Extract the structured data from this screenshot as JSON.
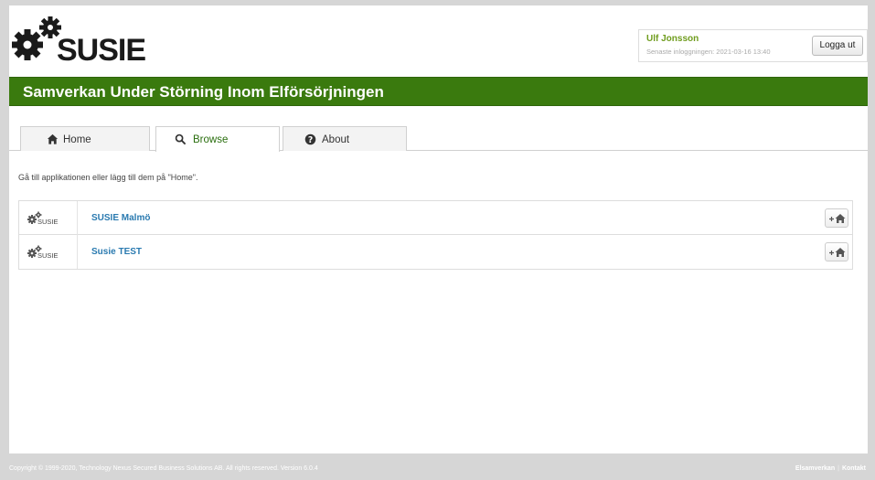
{
  "header": {
    "logo_text": "SUSIE",
    "user_name": "Ulf Jonsson",
    "last_login": "Senaste inloggningen: 2021-03-16 13:40",
    "logout_label": "Logga ut"
  },
  "banner": {
    "title": "Samverkan Under Störning Inom Elförsörjningen"
  },
  "tabs": [
    {
      "label": "Home",
      "icon": "home-icon",
      "active": false
    },
    {
      "label": "Browse",
      "icon": "search-icon",
      "active": true
    },
    {
      "label": "About",
      "icon": "info-icon",
      "active": false
    }
  ],
  "main": {
    "hint": "Gå till applikationen eller lägg till dem på \"Home\".",
    "apps": [
      {
        "logo_text": "SUSIE",
        "name": "SUSIE Malmö"
      },
      {
        "logo_text": "SUSIE",
        "name": "Susie TEST"
      }
    ]
  },
  "footer": {
    "copyright": "Copyright © 1999-2020, Technology Nexus Secured Business Solutions AB. All rights reserved. Version 6.0.4",
    "link_1": "Elsamverkan",
    "separator": "|",
    "link_2": "Kontakt"
  },
  "colors": {
    "banner": "#3a7a0e",
    "active_tab_text": "#2a6e0e",
    "user_name": "#6f9c1d",
    "app_link": "#2a7ab0"
  }
}
